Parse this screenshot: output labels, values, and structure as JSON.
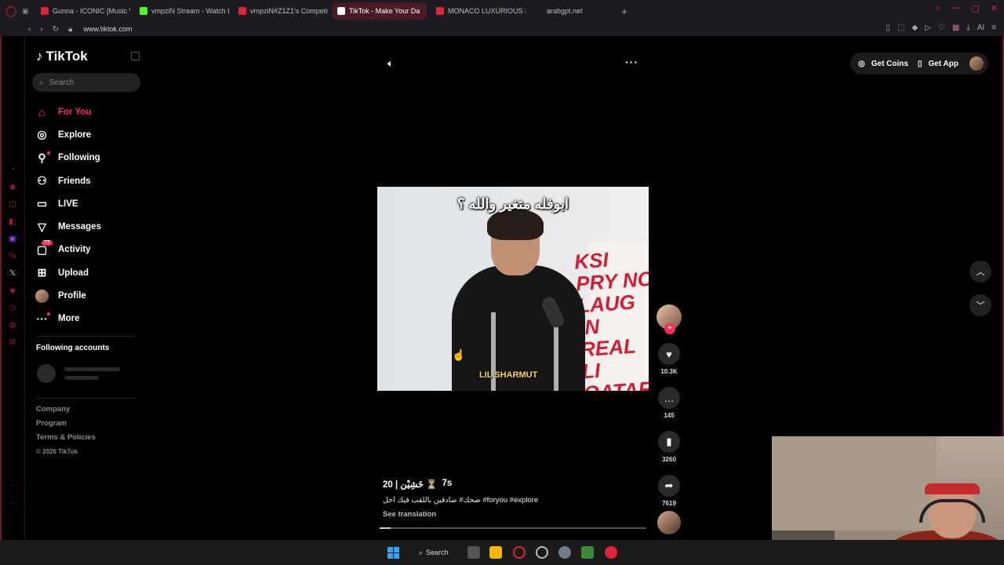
{
  "browser": {
    "tabs": [
      {
        "label": "Gunna - ICONIC [Music Vid",
        "fav_color": "#e0223a",
        "active": false
      },
      {
        "label": "vmpziN Stream - Watch Li",
        "fav_color": "#53fc18",
        "active": false
      },
      {
        "label": "vmpziN#Z1Z1's Competiti",
        "fav_color": "#e0223a",
        "active": false
      },
      {
        "label": "TikTok - Make Your Da",
        "fav_color": "#ffffff",
        "active": true
      },
      {
        "label": "MONACO LUXURIOUS RIC",
        "fav_color": "#e0223a",
        "active": false
      },
      {
        "label": "arabgpt.net",
        "fav_color": "#1c1b22",
        "active": false
      }
    ],
    "url": "www.tiktok.com"
  },
  "sidebar": {
    "logo": "TikTok",
    "search_placeholder": "Search",
    "menu": [
      {
        "label": "For You",
        "icon": "home-icon",
        "glyph": "⌂",
        "active": true
      },
      {
        "label": "Explore",
        "icon": "compass-icon",
        "glyph": "◎"
      },
      {
        "label": "Following",
        "icon": "following-icon",
        "glyph": "⚲",
        "dot": true
      },
      {
        "label": "Friends",
        "icon": "friends-icon",
        "glyph": "⚇"
      },
      {
        "label": "LIVE",
        "icon": "live-icon",
        "glyph": "▭"
      },
      {
        "label": "Messages",
        "icon": "messages-icon",
        "glyph": "▽"
      },
      {
        "label": "Activity",
        "icon": "activity-icon",
        "glyph": "▢",
        "badge": "77"
      },
      {
        "label": "Upload",
        "icon": "upload-icon",
        "glyph": "⊞"
      },
      {
        "label": "Profile",
        "icon": "profile-avatar",
        "glyph": ""
      },
      {
        "label": "More",
        "icon": "more-icon",
        "glyph": "···",
        "dot": true
      }
    ],
    "following_accounts_title": "Following accounts",
    "footer": {
      "company": "Company",
      "program": "Program",
      "terms": "Terms & Policies",
      "copyright": "© 2026 TikTok"
    }
  },
  "header": {
    "get_coins": "Get Coins",
    "get_app": "Get App"
  },
  "video": {
    "caption_top": "ابوفله متغير والله ؟",
    "caption_bottom": "LIL SHARMUT",
    "poster_text": "KSI PRY NO LAUG IN REAL LI QATAR ED"
  },
  "actions": {
    "likes": "10.3K",
    "comments": "145",
    "saves": "3260",
    "shares": "7619"
  },
  "meta": {
    "author": "خَشِيْن | 20 ⏳",
    "time": "7s",
    "description": "ضحك# صادقين باللقب فيك اجل #foryou #explore",
    "see_translation": "See translation",
    "progress": 0.04
  },
  "taskbar": {
    "search_label": "Search"
  }
}
